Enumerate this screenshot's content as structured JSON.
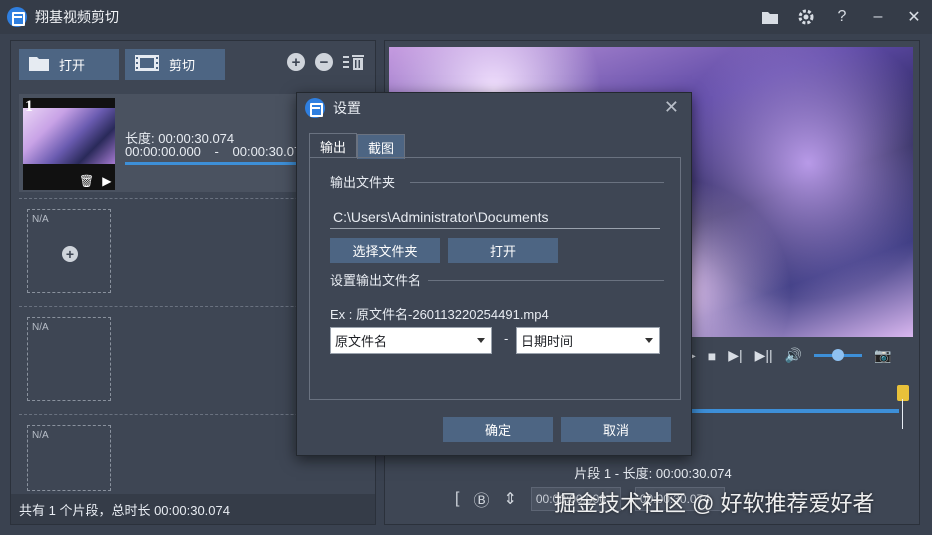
{
  "app": {
    "title": "翔基视频剪切"
  },
  "titlebar_icons": [
    "folder-icon",
    "gear-icon",
    "help-icon",
    "minimize-icon",
    "close-icon"
  ],
  "toolbar": {
    "open_label": "打开",
    "cut_label": "剪切"
  },
  "clip": {
    "number": "1",
    "length": "长度: 00:00:30.074",
    "start": "00:00:00.000",
    "separator": "-",
    "end": "00:00:30.07"
  },
  "empty_slots": [
    {
      "label": "N/A"
    },
    {
      "label": "N/A"
    },
    {
      "label": "N/A"
    }
  ],
  "status": {
    "text": "共有 1 个片段，总时长 00:00:30.074"
  },
  "segment_info": "片段 1 - 长度: 00:00:30.074",
  "time_fields": [
    "00:00:00.000",
    "00:00:30.074"
  ],
  "watermark": "掘金技术社区 @ 好软推荐爱好者",
  "dialog": {
    "title": "设置",
    "tabs": [
      {
        "label": "输出",
        "active": true
      },
      {
        "label": "截图",
        "active": false
      }
    ],
    "output_folder_label": "输出文件夹",
    "output_folder_path": "C:\\Users\\Administrator\\Documents",
    "choose_folder_label": "选择文件夹",
    "open_label": "打开",
    "filename_label": "设置输出文件名",
    "example": "Ex : 原文件名-260113220254491.mp4",
    "name_part1": "原文件名",
    "name_separator": "-",
    "name_part2": "日期时间",
    "ok_label": "确定",
    "cancel_label": "取消"
  },
  "colors": {
    "accent": "#3d8fd8",
    "button": "#4d6583",
    "panel": "#3e4654",
    "title_bar": "#353c48"
  }
}
